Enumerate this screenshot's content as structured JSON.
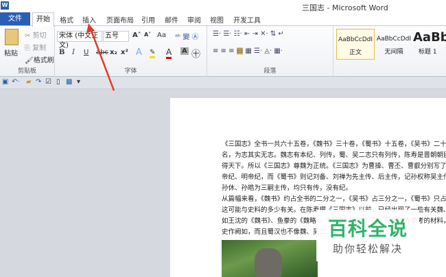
{
  "window": {
    "title": "三国志 - Microsoft Word",
    "logo": "W"
  },
  "tabs": [
    "文件",
    "开始",
    "格式",
    "插入",
    "页面布局",
    "引用",
    "邮件",
    "审阅",
    "视图",
    "开发工具"
  ],
  "clipboard": {
    "paste": "粘贴",
    "cut": "剪切",
    "copy": "复制",
    "format_painter": "格式刷",
    "label": "剪贴板"
  },
  "font": {
    "name": "宋体 (中文正文)",
    "size": "五号",
    "label": "字体",
    "bold": "B",
    "italic": "I",
    "underline": "U",
    "sub": "x₂",
    "sup": "x²",
    "grow": "A˄",
    "shrink": "A˅",
    "case": "Aa",
    "color_a": "A"
  },
  "paragraph": {
    "label": "段落"
  },
  "styles": [
    {
      "preview": "AaBbCcDdI",
      "name": "正文"
    },
    {
      "preview": "AaBbCcDdI",
      "name": "无间隔"
    },
    {
      "preview": "AaBb",
      "name": "标题 1"
    }
  ],
  "document": {
    "lines": [
      "《三国志》全书一共六十五卷，《魏书》三十卷，《蜀书》十五卷，《吴书》二十卷。《三国",
      "名，为志其实无志。魏志有本纪、列传，蜀、吴二志只有列传，陈寿是晋朝朝臣，晋承",
      "得天下。所以《三国志》尊魏为正统。《三国志》为曹操、曹丕、曹叡分别写了武帝纪",
      "帝纪、明帝纪，而《蜀书》则记刘备、刘禅为先主传、后主传，记孙权称吴主传，记",
      "孙休、孙皓为三嗣主传，均只有传，没有纪。",
      "从篇幅来看，《魏书》约占全书的二分之一，《吴书》占三分之一，《蜀书》只占六分之",
      "这可能与史料的多少有关。在陈寿撰《三国志》以前，已经出现了一些有关魏、吴的",
      "如王沈的《魏书》、鱼豢的《魏略》、韦昭的《吴书》等，可供陈寿参考的材料，而关于蜀",
      "史作阙如，而且蜀汉也不像魏、吴二"
    ]
  },
  "watermark": {
    "title": "百科全说",
    "subtitle": "助你轻松解决"
  }
}
